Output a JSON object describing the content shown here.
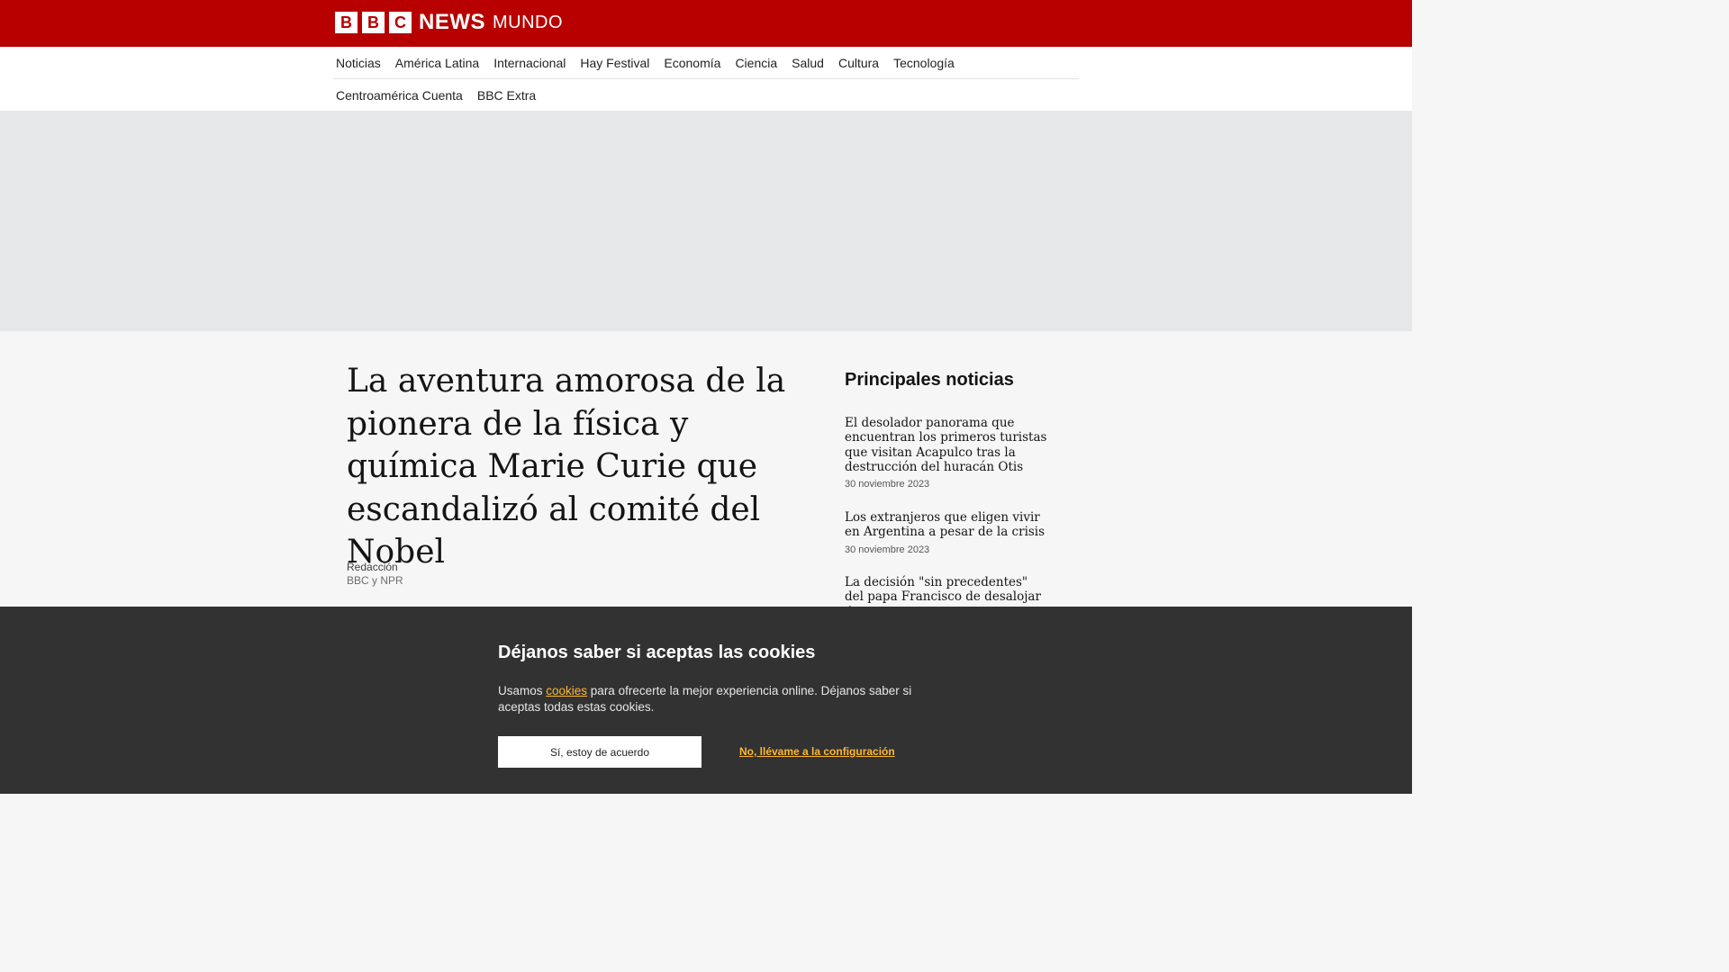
{
  "header": {
    "logo_b1": "B",
    "logo_b2": "B",
    "logo_c": "C",
    "logo_news": "NEWS",
    "logo_mundo": "MUNDO",
    "brand_color": "#b80000"
  },
  "nav": {
    "row1": [
      "Noticias",
      "América Latina",
      "Internacional",
      "Hay Festival",
      "Economía",
      "Ciencia",
      "Salud",
      "Cultura",
      "Tecnología"
    ],
    "row2": [
      "Centroamérica Cuenta",
      "BBC Extra"
    ]
  },
  "article": {
    "headline": "La aventura amorosa de la pionera de la física y química Marie Curie que escandalizó al comité del Nobel",
    "byline_name": "Redacción",
    "byline_org": "BBC y NPR"
  },
  "sidebar": {
    "title": "Principales noticias",
    "stories": [
      {
        "title": "El desolador panorama que encuentran los primeros turistas que visitan Acapulco tras la destrucción del huracán Otis",
        "date": "30 noviembre 2023"
      },
      {
        "title": "Los extranjeros que eligen vivir en Argentina a pesar de la crisis",
        "date": "30 noviembre 2023"
      },
      {
        "title": "La decisión \"sin precedentes\" del papa Francisco de desalojar de su",
        "date": ""
      }
    ]
  },
  "cookie_banner": {
    "title": "Déjanos saber si aceptas las cookies",
    "text_before": "Usamos ",
    "link_text": "cookies",
    "text_after": " para ofrecerte la mejor experiencia online. Déjanos saber si aceptas todas estas cookies.",
    "accept_label": "Sí, estoy de acuerdo",
    "settings_label": "No, llévame a la configuración",
    "link_color": "#fdb730"
  }
}
